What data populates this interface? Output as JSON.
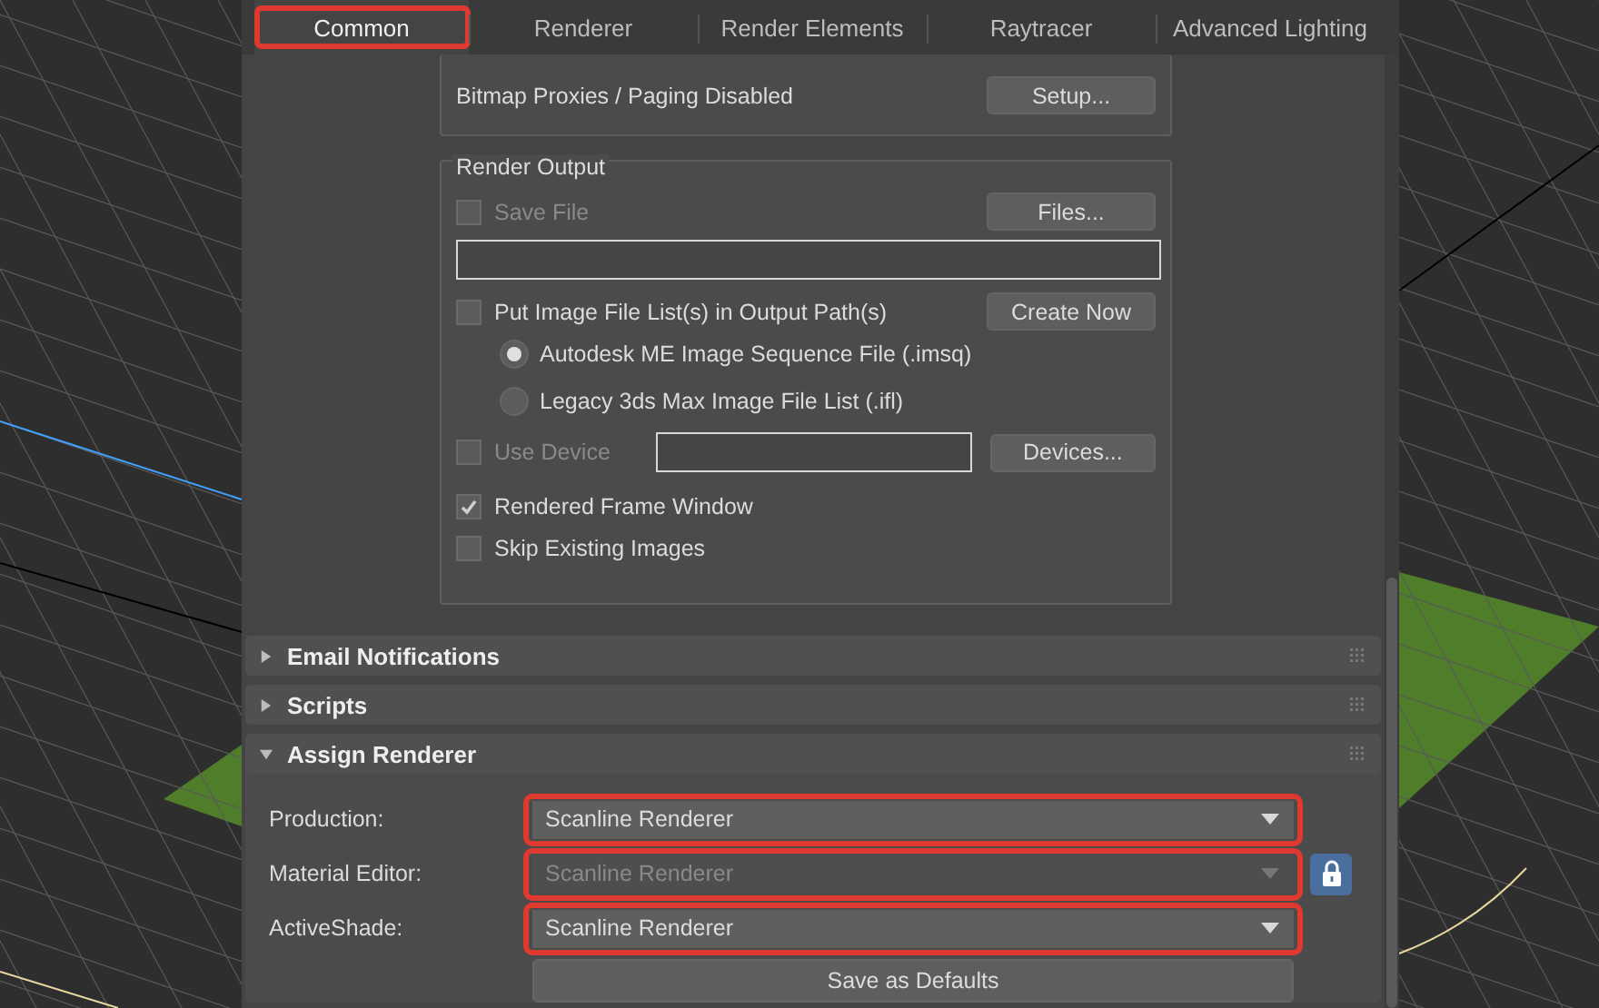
{
  "tabs": [
    {
      "label": "Common",
      "selected": true,
      "highlighted": true
    },
    {
      "label": "Renderer",
      "selected": false,
      "highlighted": false
    },
    {
      "label": "Render Elements",
      "selected": false,
      "highlighted": false
    },
    {
      "label": "Raytracer",
      "selected": false,
      "highlighted": false
    },
    {
      "label": "Advanced Lighting",
      "selected": false,
      "highlighted": false
    }
  ],
  "bitmap_group": {
    "label": "Bitmap Proxies / Paging Disabled",
    "button": "Setup..."
  },
  "render_output": {
    "title": "Render Output",
    "save_file": {
      "label": "Save File",
      "checked": false,
      "disabled": true
    },
    "files_button": "Files...",
    "put_image_list": {
      "label": "Put Image File List(s) in Output Path(s)",
      "checked": false,
      "disabled": false
    },
    "create_now_button": "Create Now",
    "radios": [
      {
        "label": "Autodesk ME Image Sequence File (.imsq)",
        "selected": true
      },
      {
        "label": "Legacy 3ds Max Image File List (.ifl)",
        "selected": false
      }
    ],
    "use_device": {
      "label": "Use Device",
      "checked": false,
      "disabled": true
    },
    "devices_button": "Devices...",
    "rendered_frame_window": {
      "label": "Rendered Frame Window",
      "checked": true,
      "disabled": false
    },
    "skip_existing_images": {
      "label": "Skip Existing Images",
      "checked": false,
      "disabled": false
    }
  },
  "rollouts": [
    {
      "title": "Email Notifications",
      "expanded": false
    },
    {
      "title": "Scripts",
      "expanded": false
    },
    {
      "title": "Assign Renderer",
      "expanded": true
    }
  ],
  "assign_renderer": {
    "rows": [
      {
        "label": "Production:",
        "value": "Scanline Renderer",
        "disabled": false,
        "highlighted": true,
        "locked": false
      },
      {
        "label": "Material Editor:",
        "value": "Scanline Renderer",
        "disabled": true,
        "highlighted": true,
        "locked": true
      },
      {
        "label": "ActiveShade:",
        "value": "Scanline Renderer",
        "disabled": false,
        "highlighted": true,
        "locked": false
      }
    ],
    "save_button": "Save as Defaults"
  }
}
